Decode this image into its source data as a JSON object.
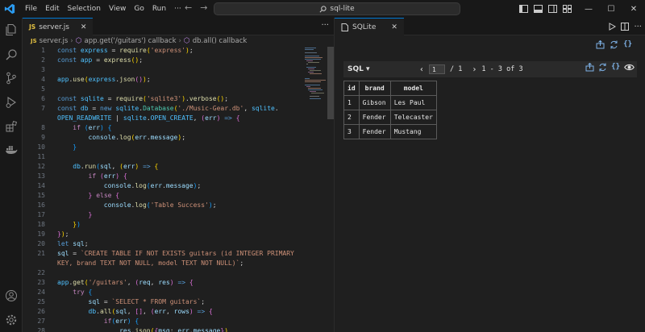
{
  "titlebar": {
    "menu": [
      "File",
      "Edit",
      "Selection",
      "View",
      "Go",
      "Run",
      "···"
    ],
    "command_center": "sql-lite"
  },
  "editor": {
    "tab_label": "server.js",
    "tab_badge": "JS",
    "breadcrumb": {
      "file": "server.js",
      "symbol1": "app.get('/guitars') callback",
      "symbol2": "db.all() callback"
    },
    "line_numbers": [
      "1",
      "2",
      "3",
      "4",
      "5",
      "6",
      "7",
      "",
      "8",
      "9",
      "10",
      "11",
      "12",
      "13",
      "14",
      "15",
      "16",
      "17",
      "18",
      "19",
      "20",
      "21",
      "",
      "22",
      "23",
      "24",
      "25",
      "26",
      "27",
      "28"
    ]
  },
  "sqlite_panel": {
    "tab_label": "SQLite",
    "sql_button": "SQL ▾",
    "page_value": "1",
    "page_total": "/ 1",
    "range": "1 - 3 of 3",
    "table": {
      "headers": [
        "id",
        "brand",
        "model"
      ],
      "rows": [
        [
          "1",
          "Gibson",
          "Les Paul"
        ],
        [
          "2",
          "Fender",
          "Telecaster"
        ],
        [
          "3",
          "Fender",
          "Mustang"
        ]
      ]
    }
  },
  "icons": {
    "activity": [
      "explorer-icon",
      "search-icon",
      "source-control-icon",
      "run-debug-icon",
      "extensions-icon",
      "docker-icon",
      "account-icon",
      "settings-gear-icon"
    ]
  },
  "colors": {
    "accent": "#0078d4",
    "background": "#1f1f1f",
    "keyword": "#569cd6",
    "string": "#ce9178",
    "function": "#dcdcaa",
    "variable": "#9cdcfe"
  }
}
